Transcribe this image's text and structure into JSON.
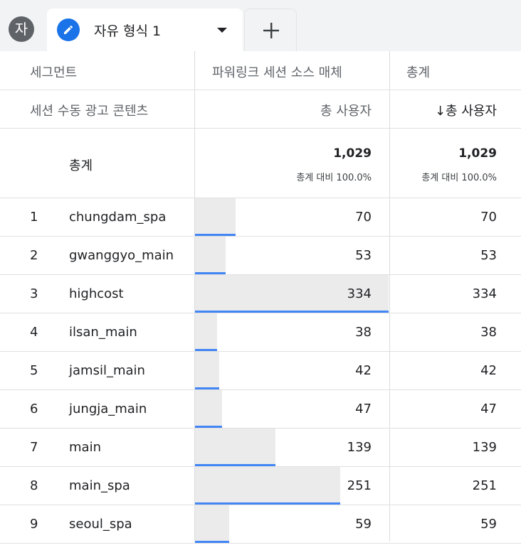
{
  "tabs": {
    "avatar_letter": "자",
    "active_label": "자유 형식 1"
  },
  "table": {
    "header1": {
      "dimension": "세그먼트",
      "col_segment": "파워링크 세션 소스 매체",
      "col_total": "총계"
    },
    "header2": {
      "dimension": "세션 수동 광고 콘텐츠",
      "metric_segment": "총 사용자",
      "metric_total": "↓총 사용자"
    },
    "totals": {
      "label": "총계",
      "segment_value": "1,029",
      "segment_sub": "총계 대비 100.0%",
      "total_value": "1,029",
      "total_sub": "총계 대비 100.0%"
    },
    "rows": [
      {
        "index": "1",
        "name": "chungdam_spa",
        "segment_value": "70",
        "total_value": "70",
        "share": 0.2096
      },
      {
        "index": "2",
        "name": "gwanggyo_main",
        "segment_value": "53",
        "total_value": "53",
        "share": 0.1587
      },
      {
        "index": "3",
        "name": "highcost",
        "segment_value": "334",
        "total_value": "334",
        "share": 1.0
      },
      {
        "index": "4",
        "name": "ilsan_main",
        "segment_value": "38",
        "total_value": "38",
        "share": 0.1138
      },
      {
        "index": "5",
        "name": "jamsil_main",
        "segment_value": "42",
        "total_value": "42",
        "share": 0.1257
      },
      {
        "index": "6",
        "name": "jungja_main",
        "segment_value": "47",
        "total_value": "47",
        "share": 0.1407
      },
      {
        "index": "7",
        "name": "main",
        "segment_value": "139",
        "total_value": "139",
        "share": 0.4162
      },
      {
        "index": "8",
        "name": "main_spa",
        "segment_value": "251",
        "total_value": "251",
        "share": 0.7515
      },
      {
        "index": "9",
        "name": "seoul_spa",
        "segment_value": "59",
        "total_value": "59",
        "share": 0.1766
      }
    ]
  },
  "colors": {
    "accent": "#1a73e8",
    "bar_fill": "#ebebeb",
    "bar_line": "#4285f4"
  }
}
